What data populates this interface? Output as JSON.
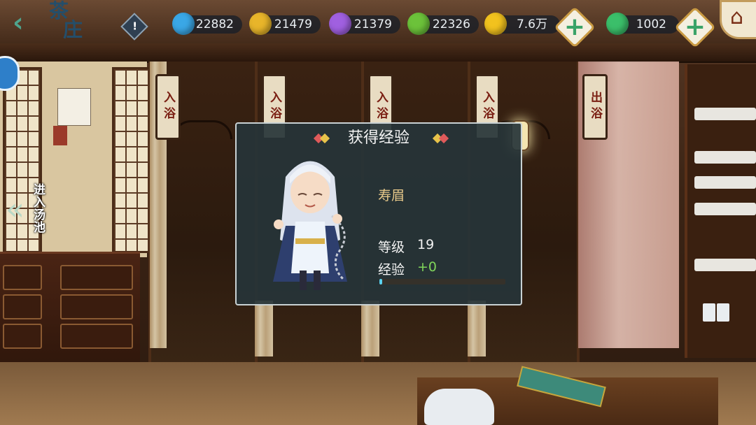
{
  "header": {
    "title_line1": "茶",
    "title_line2": "庄",
    "back_icon": "chevron-left-icon",
    "alert_icon": "exclamation-icon",
    "home_icon": "house-icon"
  },
  "resources": [
    {
      "name": "blue-gem",
      "value": "22882",
      "color": "#3aa7e6"
    },
    {
      "name": "gold-gem",
      "value": "21479",
      "color": "#e8b52a"
    },
    {
      "name": "purple-gem",
      "value": "21379",
      "color": "#a060e0"
    },
    {
      "name": "green-gem",
      "value": "22326",
      "color": "#6cc23a"
    },
    {
      "name": "gold-coin",
      "value": "7.6万",
      "color": "#f2c21e"
    },
    {
      "name": "jade-gem",
      "value": "1002",
      "color": "#3bbf6a"
    }
  ],
  "plus_label": "+",
  "scene": {
    "enter_pool_label": "进入汤池",
    "signs": [
      "入浴",
      "入浴",
      "入浴",
      "入浴",
      "出浴"
    ]
  },
  "dialog": {
    "title": "获得经验",
    "hero_name": "寿眉",
    "level_label": "等级",
    "level_value": "19",
    "exp_label": "经验",
    "exp_value": "+0",
    "exp_progress": 0.02
  }
}
